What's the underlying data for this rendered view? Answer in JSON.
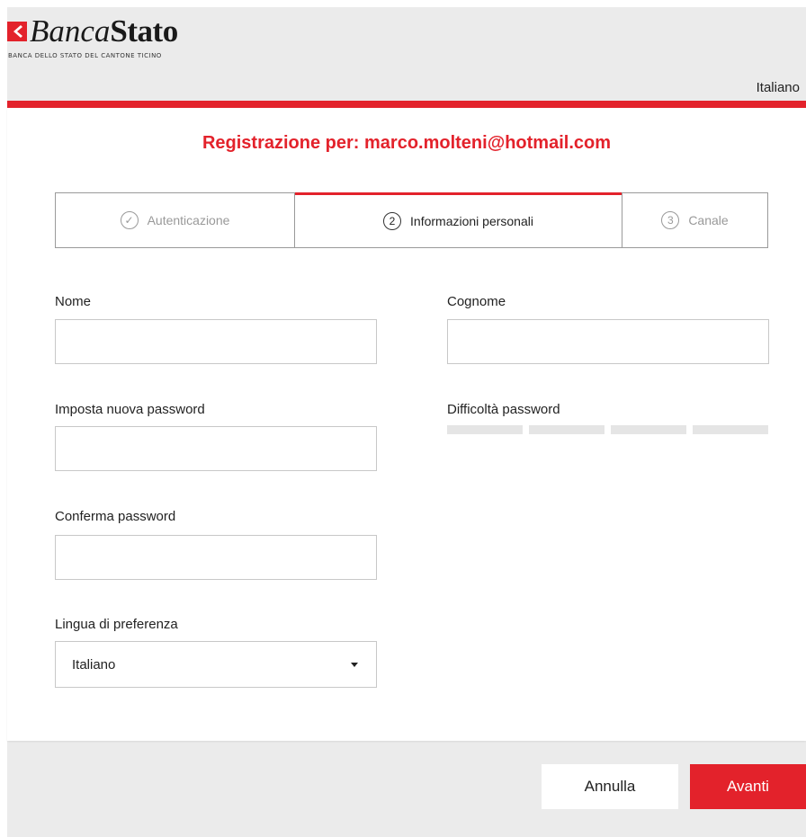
{
  "header": {
    "logo_part1": "Banca",
    "logo_part2": "Stato",
    "logo_subtitle": "BANCA DELLO STATO DEL CANTONE TICINO",
    "language": "Italiano"
  },
  "registration": {
    "title": "Registrazione per: marco.molteni@hotmail.com"
  },
  "steps": [
    {
      "marker": "✓",
      "label": "Autenticazione",
      "state": "done"
    },
    {
      "marker": "2",
      "label": "Informazioni personali",
      "state": "active"
    },
    {
      "marker": "3",
      "label": "Canale",
      "state": "pending"
    }
  ],
  "form": {
    "nome_label": "Nome",
    "nome_value": "",
    "cognome_label": "Cognome",
    "cognome_value": "",
    "password_label": "Imposta nuova password",
    "password_value": "",
    "strength_label": "Difficoltà password",
    "strength_segments_filled": 0,
    "strength_segments_total": 4,
    "confirm_label": "Conferma password",
    "confirm_value": "",
    "lingua_label": "Lingua di preferenza",
    "lingua_selected": "Italiano"
  },
  "buttons": {
    "cancel": "Annulla",
    "next": "Avanti"
  },
  "colors": {
    "brand_red": "#e3222b",
    "background": "#ebebeb",
    "strength_empty": "#e5e5e5"
  },
  "icons": {
    "logo_flag": "chevron-left-icon",
    "step_done": "check-circle-icon",
    "select_caret": "caret-down-icon"
  }
}
